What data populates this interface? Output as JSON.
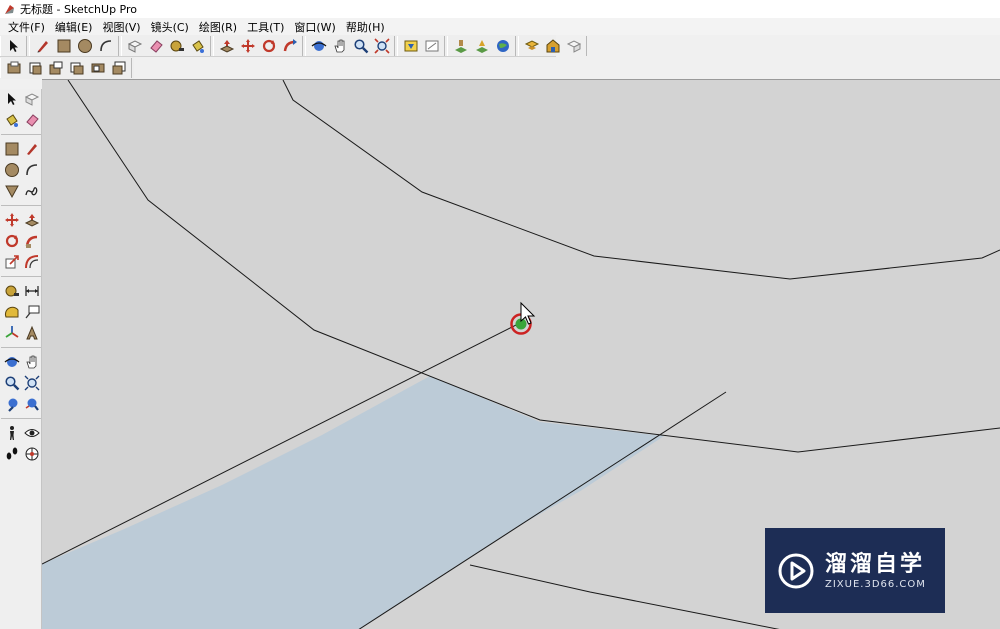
{
  "window": {
    "title": "无标题 - SketchUp Pro"
  },
  "menu": [
    {
      "label": "文件(F)"
    },
    {
      "label": "编辑(E)"
    },
    {
      "label": "视图(V)"
    },
    {
      "label": "镜头(C)"
    },
    {
      "label": "绘图(R)"
    },
    {
      "label": "工具(T)"
    },
    {
      "label": "窗口(W)"
    },
    {
      "label": "帮助(H)"
    }
  ],
  "toolbar_icons": {
    "row1": [
      "select",
      "pencil",
      "rectangle",
      "circle",
      "arc",
      "eraser-box",
      "eraser",
      "paint-bucket",
      "tape-measure",
      "push-pull",
      "move",
      "rotate",
      "follow-me",
      "orbit",
      "pan",
      "zoom",
      "zoom-extents",
      "get-models",
      "share-model",
      "section",
      "location",
      "google-earth",
      "components",
      "warehouse",
      "settings"
    ],
    "row2": [
      "layer-1",
      "layer-2",
      "layer-3",
      "layer-4",
      "layer-5",
      "layer-6"
    ]
  },
  "left_toolbar_icons": [
    "select",
    "make-component",
    "paint-bucket",
    "eraser",
    "rectangle",
    "line",
    "circle",
    "arc",
    "polygon",
    "freehand",
    "move",
    "push-pull",
    "rotate",
    "follow-me",
    "scale",
    "offset",
    "tape-measure",
    "dimension",
    "protractor",
    "text",
    "axes",
    "3d-text",
    "orbit",
    "pan",
    "zoom",
    "zoom-window",
    "previous-view",
    "zoom-extents",
    "position-camera",
    "look-around",
    "walk",
    "section-plane"
  ],
  "colors": {
    "viewport_bg": "#d3d3d3",
    "face_fill": "#bccbd7",
    "edge": "#1a1a1a",
    "inference_ring": "#cc2222",
    "inference_dot": "#3aa53a",
    "watermark_bg": "#1d2d55"
  },
  "watermark": {
    "title": "溜溜自学",
    "url": "ZIXUE.3D66.COM"
  }
}
